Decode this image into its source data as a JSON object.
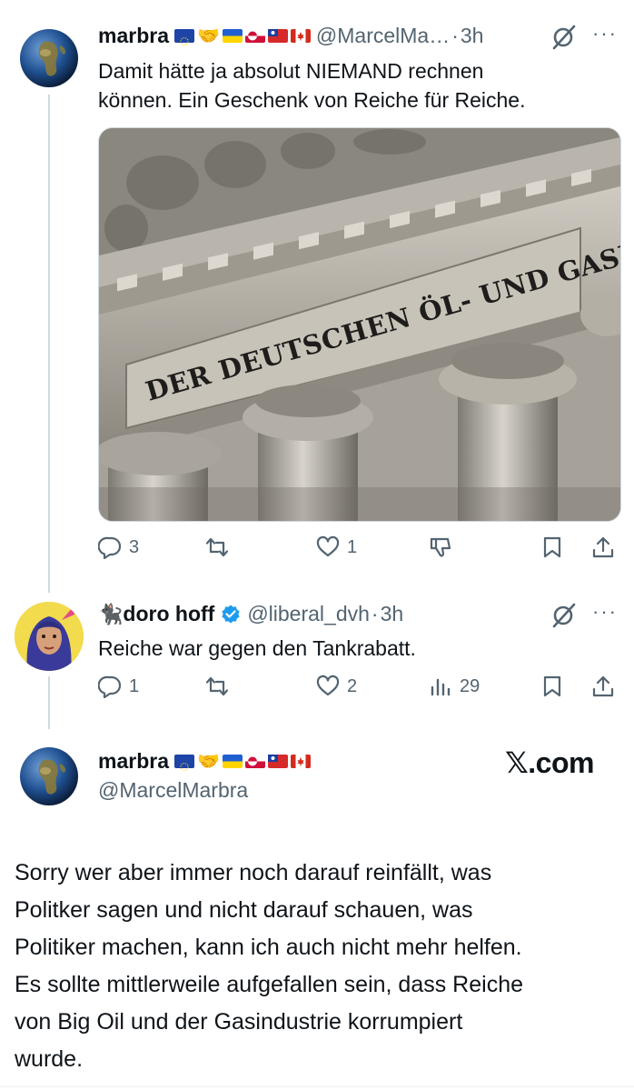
{
  "tweet1": {
    "name": "marbra",
    "handle": "@MarcelMa…",
    "separator": "·",
    "time": "3h",
    "text_line1": "Damit hätte ja absolut NIEMAND rechnen",
    "text_line2": "können. Ein Geschenk von Reiche für Reiche.",
    "image_text": "DER DEUTSCHEN ÖL- UND GASINDUSTRIE",
    "reply_count": "3",
    "like_count": "1"
  },
  "tweet2": {
    "name": "doro hoff",
    "handle": "@liberal_dvh",
    "separator": "·",
    "time": "3h",
    "text": "Reiche war gegen den Tankrabatt.",
    "reply_count": "1",
    "like_count": "2",
    "view_count": "29"
  },
  "tweet3": {
    "name": "marbra",
    "handle": "@MarcelMarbra",
    "site_label": "𝕏.com",
    "text_lines": [
      "Sorry wer aber immer noch darauf reinfällt, was",
      "Politker sagen und nicht darauf schauen, was",
      "Politiker machen, kann ich auch nicht mehr helfen.",
      "Es sollte mittlerweile aufgefallen sein, dass Reiche",
      "von Big Oil und der Gasindustrie korrumpiert",
      "wurde."
    ]
  },
  "icons": [
    "globe-avatar",
    "cat-emoji-icon",
    "verified-badge-icon",
    "reply-icon",
    "retweet-icon",
    "like-icon",
    "dislike-icon",
    "views-icon",
    "bookmark-icon",
    "share-icon",
    "grok-icon",
    "more-icon"
  ],
  "colors": {
    "text": "#0f1419",
    "secondary": "#536471",
    "verified": "#1d9bf0",
    "line": "#cfd9de"
  }
}
